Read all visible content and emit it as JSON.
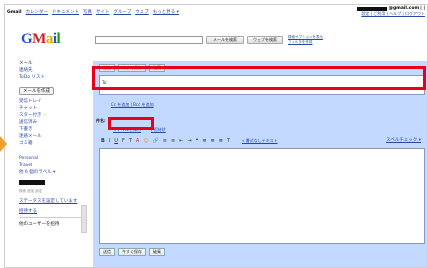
{
  "gbar": {
    "items": [
      {
        "label": "Gmail",
        "bold": true
      },
      {
        "label": "カレンダー"
      },
      {
        "label": "ドキュメント"
      },
      {
        "label": "写真"
      },
      {
        "label": "サイト"
      },
      {
        "label": "グループ"
      },
      {
        "label": "ウェブ"
      },
      {
        "label": "もっと見る ▾"
      }
    ],
    "email_suffix": "@gmail.com",
    "email_tail": "| |",
    "account_links": "設定 | ご利用 | ヘルプ | ログアウト"
  },
  "logo": {
    "letters": [
      "G",
      "M",
      "a",
      "i",
      "l"
    ]
  },
  "search": {
    "placeholder": "",
    "mail_button": "メールを検索",
    "web_button": "ウェブを検索",
    "options_line1": "検索オプションを表示",
    "options_line2": "フィルタを作成"
  },
  "sidebar": {
    "top_items": [
      "メール",
      "連絡先",
      "ToDo リスト"
    ],
    "compose": "メールを作成",
    "folders": [
      "受信トレイ",
      "チャット",
      "スター付き ",
      "送信済み",
      "下書き",
      "迷惑メール",
      "ゴミ箱"
    ],
    "star_glyph": "☆",
    "labels": [
      "Personal",
      "Travel",
      "他 6 個のラベル ▾"
    ],
    "chat_links": "検索  追加  設定",
    "status_link": "ステータスを設定しています",
    "invite": "招待する",
    "footer": "他のユーザーを招待"
  },
  "compose": {
    "send": "送信",
    "save": "今すぐ保存",
    "discard": "破棄",
    "to_label": "To:",
    "cc_links": "Cc を追加 | Bcc を追加",
    "subject_label": "件名:",
    "attach": "ファイルを添付",
    "invite_event": "| 招待状",
    "plaintext": "« 書式なしテキスト",
    "spellcheck": "スペルチェック ▾"
  },
  "toolbar_icons": [
    "B",
    "I",
    "U",
    "F",
    "T",
    "A",
    "☺",
    "🔗",
    "≡",
    "≡",
    "⇤",
    "⇥",
    "❝",
    "≣",
    "≣",
    "≣",
    "T"
  ],
  "colors": {
    "highlight": "#e8001a",
    "compose_bg": "#c3d9ff",
    "link": "#2a49a3"
  }
}
